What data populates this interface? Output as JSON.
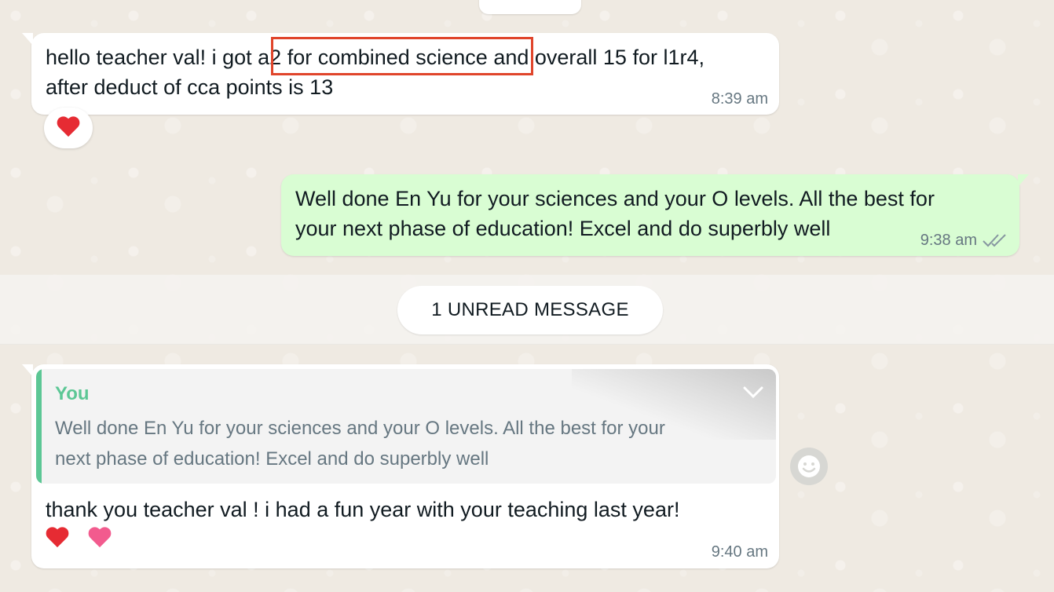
{
  "messages": {
    "incoming_1": {
      "line1": "hello teacher val! i got a2 for combined science and overall 15 for l1r4,",
      "line2": "after deduct of cca points is 13",
      "time": "8:39 am",
      "highlighted_phrase": "a2 for combined science",
      "reaction": "heart"
    },
    "outgoing_1": {
      "line1": "Well done En Yu for your sciences and your O levels. All the best for",
      "line2": "your next phase of education! Excel and do superbly well",
      "time": "9:38 am",
      "status": "read"
    },
    "unread_divider": "1 UNREAD MESSAGE",
    "incoming_2": {
      "quote_author": "You",
      "quote_line1": "Well done En Yu for your sciences and your O levels. All the best for your",
      "quote_line2": "next phase of education! Excel and do superbly well",
      "text": "thank you teacher val ! i had a fun year  with your teaching last year!",
      "emojis": [
        "red-heart",
        "pink-heart"
      ],
      "time": "9:40 am"
    }
  },
  "colors": {
    "chat_background": "#efeae2",
    "incoming_bubble": "#ffffff",
    "outgoing_bubble": "#d9fdd3",
    "quote_accent": "#5cc795",
    "highlight_box": "#e0452b",
    "timestamp": "#667781"
  },
  "icons": [
    "chevron-down-icon",
    "emoji-reaction-icon",
    "double-check-icon"
  ]
}
